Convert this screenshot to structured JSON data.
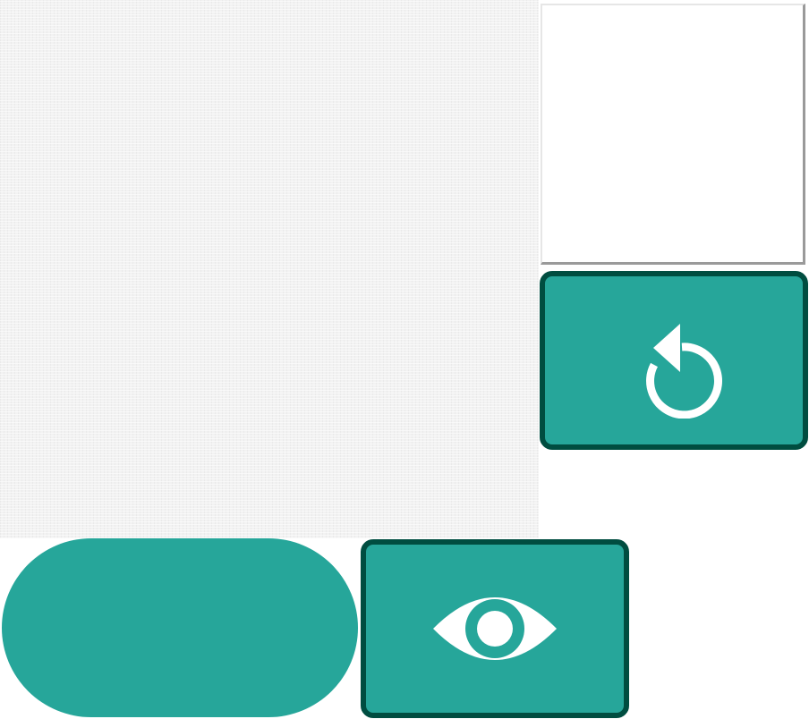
{
  "colors": {
    "accent": "#26a69a",
    "accent_border": "#004d40",
    "board_background": "#f2f2f2",
    "preview_background": "#ffffff",
    "icon_color": "#ffffff"
  },
  "controls": {
    "reset": {
      "icon": "restart-icon"
    },
    "view": {
      "icon": "eye-icon"
    },
    "pill": {
      "icon": null
    }
  }
}
